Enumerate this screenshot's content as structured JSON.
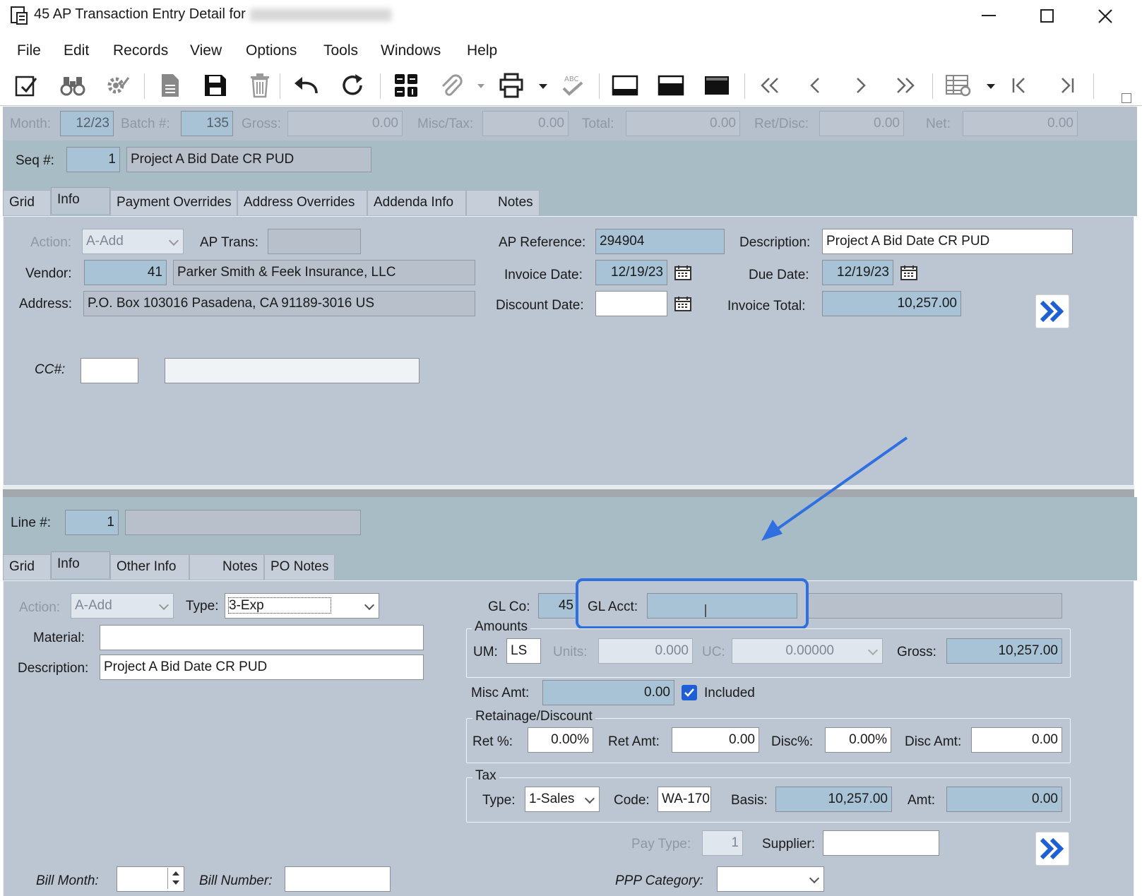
{
  "window": {
    "title": "45 AP Transaction Entry Detail for",
    "company_blurred": "Highland Industries Inc."
  },
  "menu": [
    "File",
    "Edit",
    "Records",
    "View",
    "Options",
    "Tools",
    "Windows",
    "Help"
  ],
  "header": {
    "month_label": "Month:",
    "month": "12/23",
    "batch_label": "Batch #:",
    "batch": "135",
    "gross_label": "Gross:",
    "gross": "0.00",
    "misctax_label": "Misc/Tax:",
    "misctax": "0.00",
    "total_label": "Total:",
    "total": "0.00",
    "retdisc_label": "Ret/Disc:",
    "retdisc": "0.00",
    "net_label": "Net:",
    "net": "0.00"
  },
  "seq": {
    "label": "Seq #:",
    "value": "1",
    "description": "Project A Bid Date CR PUD"
  },
  "top_tabs": [
    "Grid",
    "Info",
    "Payment Overrides",
    "Address Overrides",
    "Addenda Info",
    "Notes"
  ],
  "info": {
    "action_label": "Action:",
    "action": "A-Add",
    "aptrans_label": "AP Trans:",
    "aptrans": "",
    "apref_label": "AP Reference:",
    "apref": "294904",
    "desc_label": "Description:",
    "desc": "Project A Bid Date CR PUD",
    "vendor_label": "Vendor:",
    "vendor_num": "41",
    "vendor_name": "Parker Smith & Feek Insurance, LLC",
    "invdate_label": "Invoice Date:",
    "invdate": "12/19/23",
    "duedate_label": "Due Date:",
    "duedate": "12/19/23",
    "address_label": "Address:",
    "address": "P.O. Box 103016  Pasadena, CA  91189-3016  US",
    "discdate_label": "Discount Date:",
    "discdate": "",
    "invtotal_label": "Invoice Total:",
    "invtotal": "10,257.00",
    "cc_label": "CC#:"
  },
  "line": {
    "label": "Line #:",
    "value": "1",
    "description": ""
  },
  "line_tabs": [
    "Grid",
    "Info",
    "Other Info",
    "Notes",
    "PO Notes"
  ],
  "line_info": {
    "action_label": "Action:",
    "action": "A-Add",
    "type_label": "Type:",
    "type": "3-Exp",
    "glco_label": "GL Co:",
    "glco": "45",
    "glacct_label": "GL Acct:",
    "glacct": "",
    "material_label": "Material:",
    "material": "",
    "desc_label": "Description:",
    "desc": "Project A Bid Date CR PUD",
    "amounts_title": "Amounts",
    "um_label": "UM:",
    "um": "LS",
    "units_label": "Units:",
    "units": "0.000",
    "uc_label": "UC:",
    "uc": "0.00000",
    "gross_label": "Gross:",
    "gross": "10,257.00",
    "miscamt_label": "Misc Amt:",
    "miscamt": "0.00",
    "included_label": "Included",
    "retdisc_title": "Retainage/Discount",
    "retpct_label": "Ret %:",
    "retpct": "0.00%",
    "retamt_label": "Ret Amt:",
    "retamt": "0.00",
    "discpct_label": "Disc%:",
    "discpct": "0.00%",
    "discamt_label": "Disc Amt:",
    "discamt": "0.00",
    "tax_title": "Tax",
    "taxtype_label": "Type:",
    "taxtype": "1-Sales",
    "code_label": "Code:",
    "code": "WA-170",
    "basis_label": "Basis:",
    "basis": "10,257.00",
    "amt_label": "Amt:",
    "amt": "0.00",
    "paytype_label": "Pay Type:",
    "paytype": "1",
    "supplier_label": "Supplier:",
    "supplier": "",
    "billmonth_label": "Bill Month:",
    "billnumber_label": "Bill Number:",
    "ppp_label": "PPP Category:"
  },
  "colors": {
    "panel": "#bcc6d2",
    "band": "#a8bcc6",
    "accent": "#2f6fe0"
  }
}
